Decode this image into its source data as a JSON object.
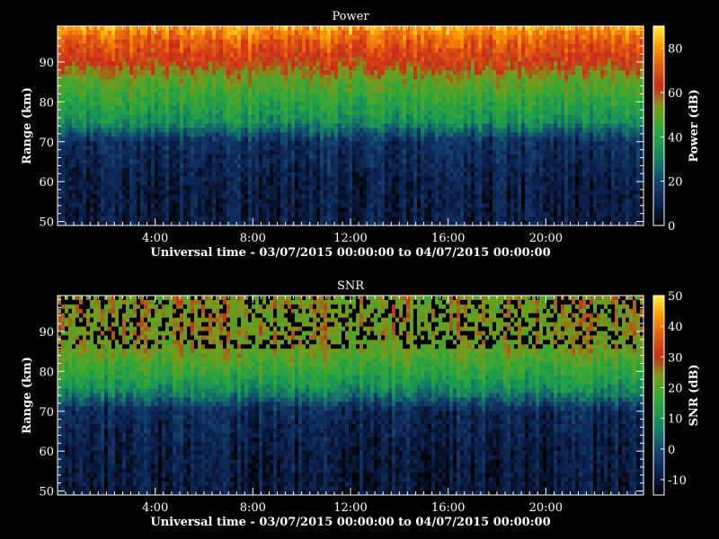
{
  "chart_data": [
    {
      "type": "heatmap",
      "title": "Power",
      "xlabel": "Universal time - 03/07/2015 00:00:00 to 04/07/2015 00:00:00",
      "ylabel": "Range (km)",
      "xlim": [
        0,
        24
      ],
      "ylim": [
        49,
        99
      ],
      "x_ticks": [
        {
          "value": 4,
          "label": "4:00"
        },
        {
          "value": 8,
          "label": "8:00"
        },
        {
          "value": 12,
          "label": "12:00"
        },
        {
          "value": 16,
          "label": "16:00"
        },
        {
          "value": 20,
          "label": "20:00"
        }
      ],
      "y_ticks": [
        {
          "value": 50,
          "label": "50"
        },
        {
          "value": 60,
          "label": "60"
        },
        {
          "value": 70,
          "label": "70"
        },
        {
          "value": 80,
          "label": "80"
        },
        {
          "value": 90,
          "label": "90"
        }
      ],
      "colorbar": {
        "label": "Power (dB)",
        "range": [
          0,
          90
        ],
        "ticks": [
          {
            "value": 0,
            "label": "0"
          },
          {
            "value": 20,
            "label": "20"
          },
          {
            "value": 40,
            "label": "40"
          },
          {
            "value": 60,
            "label": "60"
          },
          {
            "value": 80,
            "label": "80"
          }
        ]
      },
      "range_levels": [
        50,
        60,
        70,
        75,
        80,
        85,
        90,
        95,
        99
      ],
      "rows": [
        {
          "range": 50,
          "value": 8
        },
        {
          "range": 60,
          "value": 9
        },
        {
          "range": 70,
          "value": 14
        },
        {
          "range": 75,
          "value": 34
        },
        {
          "range": 80,
          "value": 42
        },
        {
          "range": 85,
          "value": 50
        },
        {
          "range": 90,
          "value": 64
        },
        {
          "range": 95,
          "value": 72
        },
        {
          "range": 99,
          "value": 82
        }
      ]
    },
    {
      "type": "heatmap",
      "title": "SNR",
      "xlabel": "Universal time - 03/07/2015 00:00:00 to 04/07/2015 00:00:00",
      "ylabel": "Range (km)",
      "xlim": [
        0,
        24
      ],
      "ylim": [
        49,
        99
      ],
      "x_ticks": [
        {
          "value": 4,
          "label": "4:00"
        },
        {
          "value": 8,
          "label": "8:00"
        },
        {
          "value": 12,
          "label": "12:00"
        },
        {
          "value": 16,
          "label": "16:00"
        },
        {
          "value": 20,
          "label": "20:00"
        }
      ],
      "y_ticks": [
        {
          "value": 50,
          "label": "50"
        },
        {
          "value": 60,
          "label": "60"
        },
        {
          "value": 70,
          "label": "70"
        },
        {
          "value": 80,
          "label": "80"
        },
        {
          "value": 90,
          "label": "90"
        }
      ],
      "colorbar": {
        "label": "SNR (dB)",
        "range": [
          -15,
          50
        ],
        "ticks": [
          {
            "value": -10,
            "label": "-10"
          },
          {
            "value": 0,
            "label": "0"
          },
          {
            "value": 10,
            "label": "10"
          },
          {
            "value": 20,
            "label": "20"
          },
          {
            "value": 30,
            "label": "30"
          },
          {
            "value": 40,
            "label": "40"
          },
          {
            "value": 50,
            "label": "50"
          }
        ]
      },
      "rows": [
        {
          "range": 50,
          "value": -10
        },
        {
          "range": 60,
          "value": -9
        },
        {
          "range": 70,
          "value": -6
        },
        {
          "range": 75,
          "value": 8
        },
        {
          "range": 80,
          "value": 16
        },
        {
          "range": 85,
          "value": 22
        },
        {
          "range": 90,
          "value": 24
        },
        {
          "range": 95,
          "value": 24
        },
        {
          "range": 99,
          "value": 24
        }
      ]
    }
  ],
  "colormap": [
    "#000000",
    "#0b1f4a",
    "#123a6b",
    "#146e6a",
    "#1a9a52",
    "#38a835",
    "#7a9a1a",
    "#cc2a1a",
    "#e05a12",
    "#ff9a00",
    "#ffee40"
  ]
}
